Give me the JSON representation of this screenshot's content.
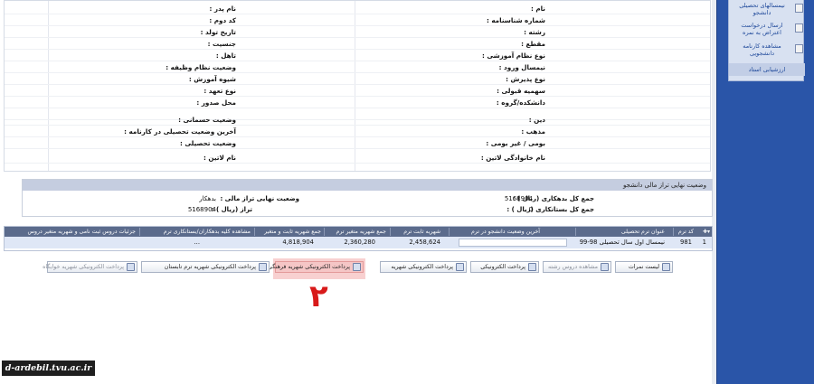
{
  "student_info": {
    "rows": [
      {
        "right_label": "نام :",
        "right_value": "",
        "left_label": "نام پدر :",
        "left_value": ""
      },
      {
        "right_label": "شماره شناسنامه :",
        "right_value": "",
        "left_label": "کد دوم :",
        "left_value": ""
      },
      {
        "right_label": "رشته :",
        "right_value": "",
        "left_label": "تاریخ تولد :",
        "left_value": ""
      },
      {
        "right_label": "مقطع :",
        "right_value": "",
        "left_label": "جنسیت :",
        "left_value": ""
      },
      {
        "right_label": "نوع نظام آموزشی :",
        "right_value": "",
        "left_label": "تاهل :",
        "left_value": ""
      },
      {
        "right_label": "نیمسال ورود :",
        "right_value": "",
        "left_label": "وضعیت نظام وظیفه :",
        "left_value": ""
      },
      {
        "right_label": "نوع پذیرش :",
        "right_value": "",
        "left_label": "شیوه آموزش :",
        "left_value": ""
      },
      {
        "right_label": "سهمیه قبولی :",
        "right_value": "",
        "left_label": "نوع تعهد :",
        "left_value": ""
      },
      {
        "right_label": "دانشکده/گروه :",
        "right_value": "",
        "left_label": "محل صدور :",
        "left_value": ""
      },
      {
        "right_label": "",
        "right_value": "",
        "left_label": "",
        "left_value": ""
      },
      {
        "right_label": "دین :",
        "right_value": "",
        "left_label": "وضعیت حسمانی :",
        "left_value": ""
      },
      {
        "right_label": "مذهب :",
        "right_value": "",
        "left_label": "آخرین وضعیت تحصیلی در کارنامه :",
        "left_value": ""
      },
      {
        "right_label": "بومی / غیر بومی :",
        "right_value": "",
        "left_label": "وضعیت تحصیلی :",
        "left_value": ""
      },
      {
        "right_label": "نام خانوادگی لاتین :",
        "right_value": "",
        "left_label": "نام لاتین :",
        "left_value": ""
      }
    ]
  },
  "sidebar": {
    "items": [
      {
        "label": "نیمسالهای تحصیلی دانشجو",
        "icon": "folder-icon"
      },
      {
        "label": "ارسال درخواست اعتراض به نمره",
        "icon": "document-icon"
      },
      {
        "label": "مشاهده کارنامه دانشجویی",
        "icon": "report-icon"
      }
    ],
    "active_label": "ارزشیابی استاد"
  },
  "financial": {
    "title": "وضعیت نهایی تراز مالی دانشجو",
    "debt_label": "جمع کل بدهکاری (ریال ) :",
    "debt_value": "5168904",
    "credit_label": "جمع کل بستانکاری (ریال ) :",
    "credit_value": "0",
    "status_label": "وضعیت نهایی تراز مالی :",
    "status_value": "بدهکار",
    "balance_label": "تراز (ریال ) :",
    "balance_value": "5168904"
  },
  "grid": {
    "headers": [
      "کد ترم",
      "عنوان ترم تحصیلی",
      "آخرین وضعیت دانشجو در ترم",
      "شهریه ثابت ترم",
      "جمع شهریه متغیر ترم",
      "جمع شهریه ثابت و متغیر",
      "مشاهده کلیه بدهکاران/بستانکاری ترم",
      "جزئیات دروس ثبت نامی و شهریه متغیر دروس"
    ],
    "row": {
      "index": "1",
      "term_code": "981",
      "term_title": "نیمسال اول سال تحصیلی 98-99",
      "status": "",
      "fixed_fee": "2,458,624",
      "variable_fee": "2,360,280",
      "total": "4,818,904",
      "all_debts": "...",
      "details": ""
    }
  },
  "buttons": {
    "grades": "لیست نمرات",
    "courses": "مشاهده دروس رشته",
    "electronic": "پرداخت الکترونیکی",
    "tuition": "پرداخت الکترونیکی شهریه",
    "cultural": "پرداخت الکترونیکی شهریه فرهنگی",
    "summer": "پرداخت الکترونیکی شهریه ترم تابستان",
    "dorm": "پرداخت الکترونیکی شهریه خوابگاه"
  },
  "annotation": "۲",
  "watermark": "d-ardebil.tvu.ac.ir",
  "colors": {
    "sidebar": "#2a55a8",
    "highlight": "#f5c6c6",
    "annotation": "#d81a1a",
    "grid_header": "#5b6b8c"
  }
}
